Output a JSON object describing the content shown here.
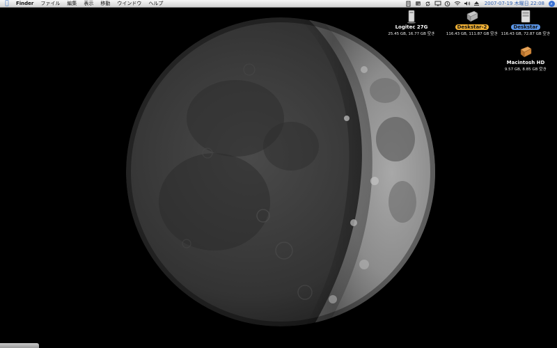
{
  "menubar": {
    "apple_icon": "apple-icon",
    "app_name": "Finder",
    "items": [
      "ファイル",
      "編集",
      "表示",
      "移動",
      "ウインドウ",
      "ヘルプ"
    ],
    "clock": "2007-07-19 木曜日 22:08",
    "status_icons": [
      "script-menu-icon",
      "disk-icon",
      "sync-icon",
      "display-icon",
      "time-machine-icon",
      "wifi-icon",
      "volume-icon",
      "eject-icon"
    ],
    "spotlight_icon": "spotlight-icon"
  },
  "desktop": {
    "icons": [
      {
        "name": "Logitec 27G",
        "info": "25.45 GB, 16.77 GB 空き",
        "label": "none"
      },
      {
        "name": "Deskstar-2",
        "info": "116.43 GB, 111.87 GB 空き",
        "label": "orange"
      },
      {
        "name": "Deskstar",
        "info": "116.43 GB, 72.87 GB 空き",
        "label": "blue"
      },
      {
        "name": "Macintosh HD",
        "info": "9.57 GB, 8.85 GB 空き",
        "label": "none"
      }
    ]
  },
  "wallpaper": {
    "subject": "waxing half moon"
  },
  "colors": {
    "menubar": "#e6e6e6",
    "clock": "#2f5fb0",
    "desktop": "#000000"
  }
}
